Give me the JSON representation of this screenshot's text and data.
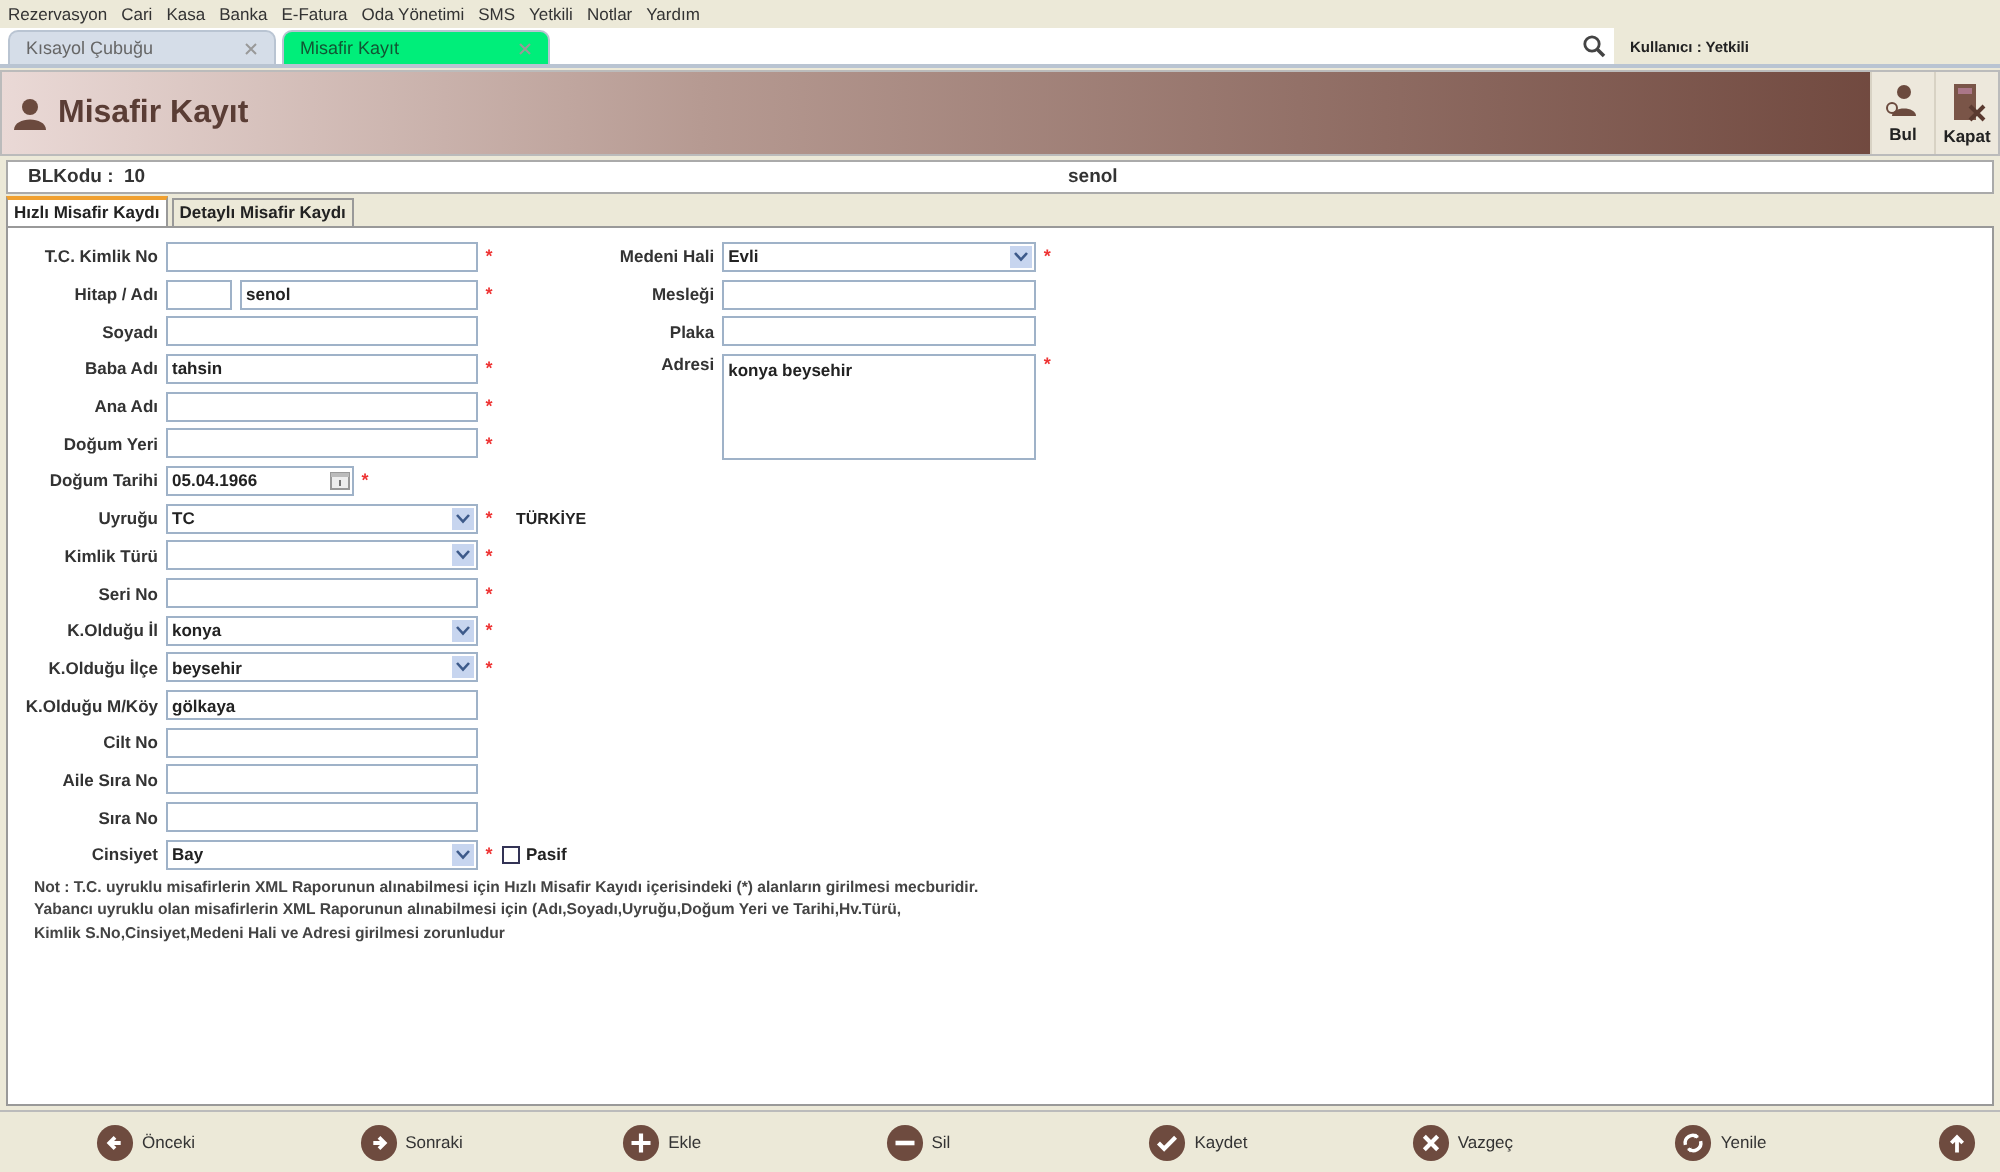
{
  "menu": [
    "Rezervasyon",
    "Cari",
    "Kasa",
    "Banka",
    "E-Fatura",
    "Oda Yönetimi",
    "SMS",
    "Yetkili",
    "Notlar",
    "Yardım"
  ],
  "tabs": [
    {
      "label": "Kısayol Çubuğu",
      "selected": false
    },
    {
      "label": "Misafir Kayıt",
      "selected": true
    }
  ],
  "user": "Kullanıcı : Yetkili",
  "header": {
    "title": "Misafir Kayıt",
    "actions": [
      {
        "label": "Bul",
        "kind": "find"
      },
      {
        "label": "Kapat",
        "kind": "close"
      }
    ]
  },
  "record": {
    "code": "BLKodu :  10",
    "name": "senol"
  },
  "subtabs": [
    {
      "label": "Hızlı Misafir Kaydı",
      "selected": true
    },
    {
      "label": "Detaylı Misafir Kaydı",
      "selected": false
    }
  ],
  "left_fields": [
    {
      "label": "T.C. Kimlik No",
      "kind": "text",
      "marker": "*"
    },
    {
      "label": "Hitap / Adı",
      "kind": "split",
      "value": "senol",
      "marker": "*"
    },
    {
      "label": "Soyadı",
      "kind": "text"
    },
    {
      "label": "Baba Adı",
      "kind": "text",
      "value": "tahsin",
      "marker": "*"
    },
    {
      "label": "Ana Adı",
      "kind": "text",
      "marker": "*"
    },
    {
      "label": "Doğum Yeri",
      "kind": "text",
      "marker": "*"
    },
    {
      "label": "Doğum Tarihi",
      "kind": "date",
      "value": "05.04.1966",
      "marker": "*"
    },
    {
      "label": "Uyruğu",
      "kind": "select",
      "value": "TC",
      "marker": "*",
      "note": "TÜRKİYE"
    },
    {
      "label": "Kimlik Türü",
      "kind": "select",
      "marker": "*"
    },
    {
      "label": "Seri No",
      "kind": "text",
      "marker": "*"
    },
    {
      "label": "K.Olduğu İl",
      "kind": "select",
      "value": "konya",
      "marker": "*"
    },
    {
      "label": "K.Olduğu İlçe",
      "kind": "select",
      "value": "beysehir",
      "marker": "*"
    },
    {
      "label": "K.Olduğu M/Köy",
      "kind": "text",
      "value": "gölkaya"
    },
    {
      "label": "Cilt No",
      "kind": "text"
    },
    {
      "label": "Aile Sıra No",
      "kind": "text"
    },
    {
      "label": "Sıra No",
      "kind": "text"
    },
    {
      "label": "Cinsiyet",
      "kind": "select",
      "value": "Bay",
      "marker": "*",
      "checkbox": {
        "label": "Pasif",
        "checked": false
      }
    }
  ],
  "right_fields": [
    {
      "label": "Medeni Hali",
      "kind": "select",
      "value": "Evli",
      "marker": "*"
    },
    {
      "label": "Mesleği",
      "kind": "text"
    },
    {
      "label": "Plaka",
      "kind": "text"
    },
    {
      "label": "Adresi",
      "kind": "textarea",
      "value": "konya beysehir",
      "marker": "*"
    }
  ],
  "note": [
    "Not : T.C. uyruklu misafirlerin XML Raporunun alınabilmesi için Hızlı Misafir Kayıdı içerisindeki (*) alanların girilmesi mecburidir.",
    "Yabancı uyruklu olan misafirlerin XML Raporunun alınabilmesi için (Adı,Soyadı,Uyruğu,Doğum Yeri ve Tarihi,Hv.Türü,",
    "Kimlik S.No,Cinsiyet,Medeni Hali ve Adresi girilmesi zorunludur"
  ],
  "footer_buttons": [
    {
      "label": "Önceki",
      "kind": "prev"
    },
    {
      "label": "Sonraki",
      "kind": "next"
    },
    {
      "label": "Ekle",
      "kind": "add"
    },
    {
      "label": "Sil",
      "kind": "remove"
    },
    {
      "label": "Kaydet",
      "kind": "save"
    },
    {
      "label": "Vazgeç",
      "kind": "cancel"
    },
    {
      "label": "Yenile",
      "kind": "refresh"
    },
    {
      "kind": "up"
    }
  ]
}
